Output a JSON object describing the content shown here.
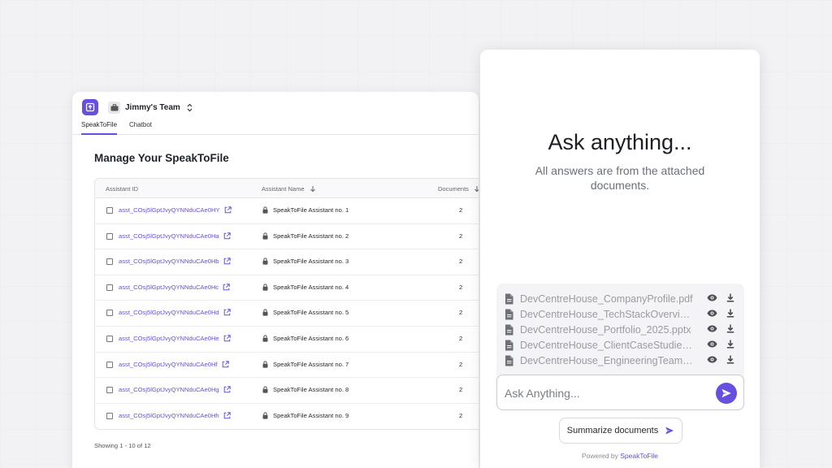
{
  "colors": {
    "accent": "#6650e0",
    "background": "#f2f2f4"
  },
  "header": {
    "logo_icon": "file-upload-icon",
    "team_icon": "briefcase-icon",
    "team_name": "Jimmy's Team",
    "team_switch_icon": "chevron-up-down-icon"
  },
  "tabs": [
    {
      "label": "SpeakToFile",
      "active": true
    },
    {
      "label": "Chatbot",
      "active": false
    }
  ],
  "main": {
    "title": "Manage Your SpeakToFile",
    "columns": {
      "id": "Assistant ID",
      "name": "Assistant Name",
      "docs": "Documents"
    },
    "rows": [
      {
        "id": "asst_COsj5lGptJvyQYNNduCAe0HY",
        "name": "SpeakToFile Assistant no. 1",
        "docs": "2"
      },
      {
        "id": "asst_COsj5lGptJvyQYNNduCAe0Ha",
        "name": "SpeakToFile Assistant no. 2",
        "docs": "2"
      },
      {
        "id": "asst_COsj5lGptJvyQYNNduCAe0Hb",
        "name": "SpeakToFile Assistant no. 3",
        "docs": "2"
      },
      {
        "id": "asst_COsj5lGptJvyQYNNduCAe0Hc",
        "name": "SpeakToFile Assistant no. 4",
        "docs": "2"
      },
      {
        "id": "asst_COsj5lGptJvyQYNNduCAe0Hd",
        "name": "SpeakToFile Assistant no. 5",
        "docs": "2"
      },
      {
        "id": "asst_COsj5lGptJvyQYNNduCAe0He",
        "name": "SpeakToFile Assistant no. 6",
        "docs": "2"
      },
      {
        "id": "asst_COsj5lGptJvyQYNNduCAe0Hf",
        "name": "SpeakToFile Assistant no. 7",
        "docs": "2"
      },
      {
        "id": "asst_COsj5lGptJvyQYNNduCAe0Hg",
        "name": "SpeakToFile Assistant no. 8",
        "docs": "2"
      },
      {
        "id": "asst_COsj5lGptJvyQYNNduCAe0Hh",
        "name": "SpeakToFile Assistant no. 9",
        "docs": "2"
      }
    ],
    "showing": "Showing 1 - 10 of 12"
  },
  "chat": {
    "title": "Ask anything...",
    "subtitle": "All answers are from the attached documents.",
    "files": [
      "DevCentreHouse_CompanyProfile.pdf",
      "DevCentreHouse_TechStackOverview.pdf",
      "DevCentreHouse_Portfolio_2025.pptx",
      "DevCentreHouse_ClientCaseStudies.pdf",
      "DevCentreHouse_EngineeringTeamBios.pdf"
    ],
    "input_placeholder": "Ask Anything...",
    "summarize_label": "Summarize documents",
    "powered_prefix": "Powered by",
    "powered_brand": "SpeakToFile"
  }
}
